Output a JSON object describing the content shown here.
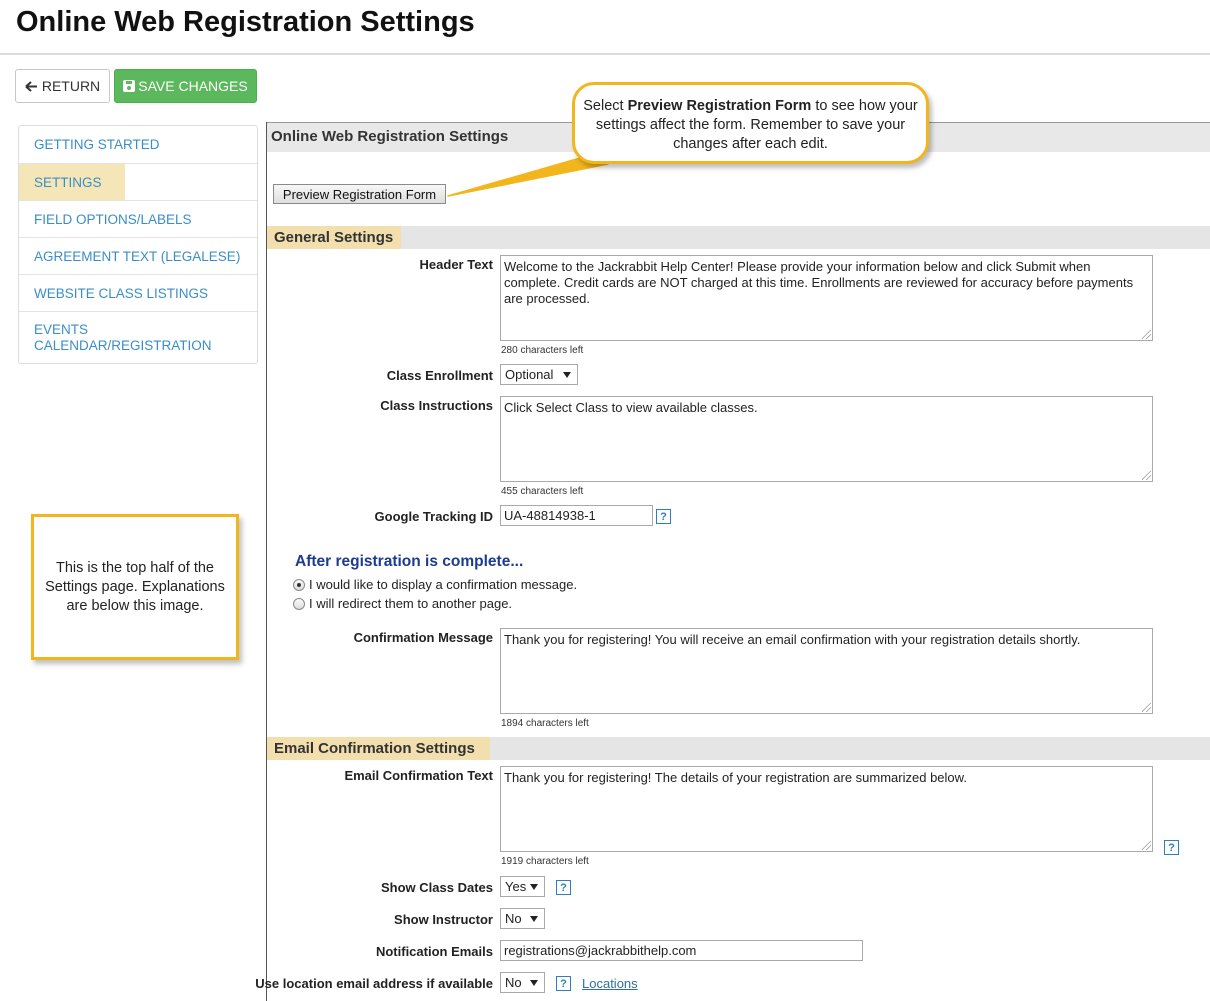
{
  "page": {
    "title": "Online Web Registration Settings"
  },
  "toolbar": {
    "return_label": "RETURN",
    "save_label": "SAVE CHANGES",
    "return_icon": "arrow-left",
    "save_icon": "floppy-disk",
    "save_color": "#5cb85c"
  },
  "sidebar": {
    "items": [
      {
        "label": "GETTING STARTED",
        "active": false
      },
      {
        "label": "SETTINGS",
        "active": true
      },
      {
        "label": "FIELD OPTIONS/LABELS",
        "active": false
      },
      {
        "label": "AGREEMENT TEXT (LEGALESE)",
        "active": false
      },
      {
        "label": "WEBSITE CLASS LISTINGS",
        "active": false
      },
      {
        "label": "EVENTS CALENDAR/REGISTRATION",
        "active": false
      }
    ],
    "active_color": "#f5e6b8",
    "link_color": "#3a8ec7"
  },
  "left_callout": {
    "text": "This is the top half of the Settings page. Explanations are below this image."
  },
  "top_callout": {
    "prefix": "Select ",
    "bold": "Preview Registration Form",
    "suffix": " to see how your settings affect the form. Remember to save your changes after each edit."
  },
  "panel": {
    "header": "Online Web Registration Settings",
    "preview_button": "Preview Registration Form"
  },
  "general": {
    "section_title": "General Settings",
    "header_text": {
      "label": "Header Text",
      "value": "Welcome to the Jackrabbit Help Center! Please provide your information below and click Submit when complete. Credit cards are NOT charged at this time. Enrollments are reviewed for accuracy before payments are processed.",
      "chars_left": "280 characters left"
    },
    "class_enrollment": {
      "label": "Class Enrollment",
      "value": "Optional"
    },
    "class_instructions": {
      "label": "Class Instructions",
      "value": "Click Select Class to view available classes.",
      "chars_left": "455 characters left"
    },
    "google_tracking": {
      "label": "Google Tracking ID",
      "value": "UA-48814938-1",
      "help": "?"
    }
  },
  "after_registration": {
    "heading": "After registration is complete...",
    "options": [
      {
        "label": "I would like to display a confirmation message.",
        "selected": true
      },
      {
        "label": "I will redirect them to another page.",
        "selected": false
      }
    ],
    "confirmation_message": {
      "label": "Confirmation Message",
      "value": "Thank you for registering! You will receive an email confirmation with your registration details shortly.",
      "chars_left": "1894 characters left"
    }
  },
  "email": {
    "section_title": "Email Confirmation Settings",
    "confirmation_text": {
      "label": "Email Confirmation Text",
      "value": "Thank you for registering! The details of your registration are summarized below.",
      "chars_left": "1919 characters left"
    },
    "show_class_dates": {
      "label": "Show Class Dates",
      "value": "Yes"
    },
    "show_instructor": {
      "label": "Show Instructor",
      "value": "No"
    },
    "notification_emails": {
      "label": "Notification Emails",
      "value": "registrations@jackrabbithelp.com"
    },
    "use_location_email": {
      "label": "Use location email address if available",
      "value": "No",
      "link": "Locations"
    },
    "help": "?"
  },
  "colors": {
    "callout_border": "#f2b51c",
    "section_tab": "#f3dfae",
    "heading_blue": "#1d3b8f",
    "help_blue": "#2d7fb8"
  }
}
